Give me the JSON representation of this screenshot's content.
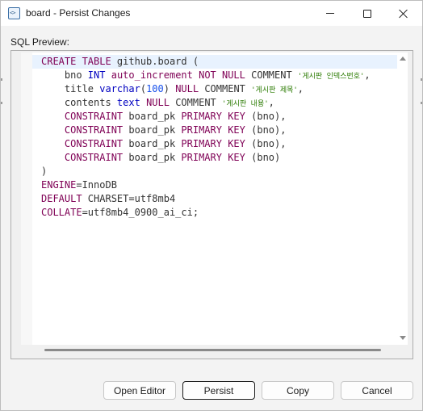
{
  "window": {
    "title": "board - Persist Changes",
    "icon": "code-file-icon"
  },
  "title_controls": {
    "minimize": "minimize-icon",
    "maximize": "maximize-icon",
    "close": "close-icon"
  },
  "preview": {
    "label": "SQL Preview:",
    "lines": [
      [
        [
          "kw",
          "CREATE TABLE"
        ],
        [
          "op",
          " github.board ("
        ]
      ],
      [
        [
          "op",
          "    bno "
        ],
        [
          "dt",
          "INT"
        ],
        [
          "op",
          " "
        ],
        [
          "kw",
          "auto_increment NOT NULL"
        ],
        [
          "op",
          " COMMENT "
        ],
        [
          "st",
          "'게시판 인덱스번호'"
        ],
        [
          "op",
          ","
        ]
      ],
      [
        [
          "op",
          "    title "
        ],
        [
          "dt",
          "varchar"
        ],
        [
          "op",
          "("
        ],
        [
          "nm",
          "100"
        ],
        [
          "op",
          ") "
        ],
        [
          "kw",
          "NULL"
        ],
        [
          "op",
          " COMMENT "
        ],
        [
          "st",
          "'게시판 제목'"
        ],
        [
          "op",
          ","
        ]
      ],
      [
        [
          "op",
          "    contents "
        ],
        [
          "dt",
          "text"
        ],
        [
          "op",
          " "
        ],
        [
          "kw",
          "NULL"
        ],
        [
          "op",
          " COMMENT "
        ],
        [
          "st",
          "'게시판 내용'"
        ],
        [
          "op",
          ","
        ]
      ],
      [
        [
          "op",
          "    "
        ],
        [
          "kw",
          "CONSTRAINT"
        ],
        [
          "op",
          " board_pk "
        ],
        [
          "kw",
          "PRIMARY KEY"
        ],
        [
          "op",
          " (bno),"
        ]
      ],
      [
        [
          "op",
          "    "
        ],
        [
          "kw",
          "CONSTRAINT"
        ],
        [
          "op",
          " board_pk "
        ],
        [
          "kw",
          "PRIMARY KEY"
        ],
        [
          "op",
          " (bno),"
        ]
      ],
      [
        [
          "op",
          "    "
        ],
        [
          "kw",
          "CONSTRAINT"
        ],
        [
          "op",
          " board_pk "
        ],
        [
          "kw",
          "PRIMARY KEY"
        ],
        [
          "op",
          " (bno),"
        ]
      ],
      [
        [
          "op",
          "    "
        ],
        [
          "kw",
          "CONSTRAINT"
        ],
        [
          "op",
          " board_pk "
        ],
        [
          "kw",
          "PRIMARY KEY"
        ],
        [
          "op",
          " (bno)"
        ]
      ],
      [
        [
          "op",
          ")"
        ]
      ],
      [
        [
          "kw",
          "ENGINE"
        ],
        [
          "op",
          "=InnoDB"
        ]
      ],
      [
        [
          "kw",
          "DEFAULT"
        ],
        [
          "op",
          " CHARSET=utf8mb4"
        ]
      ],
      [
        [
          "kw",
          "COLLATE"
        ],
        [
          "op",
          "=utf8mb4_0900_ai_ci;"
        ]
      ]
    ]
  },
  "buttons": {
    "open_editor": "Open Editor",
    "persist": "Persist",
    "copy": "Copy",
    "cancel": "Cancel"
  }
}
